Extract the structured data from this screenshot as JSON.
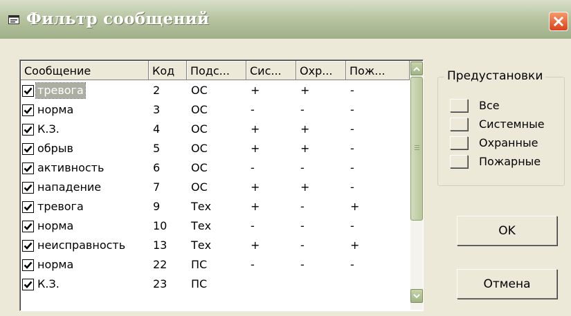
{
  "window": {
    "title": "Фильтр сообщений",
    "icon": "window-icon",
    "close_icon": "close-icon",
    "accent_color": "#d9431a"
  },
  "list": {
    "columns": [
      "Сообщение",
      "Код",
      "Подс...",
      "Сис...",
      "Охр...",
      "Пож..."
    ],
    "rows": [
      {
        "checked": true,
        "message": "тревога",
        "code": "2",
        "subsystem": "ОС",
        "system": "+",
        "security": "+",
        "fire": "-",
        "selected": true
      },
      {
        "checked": true,
        "message": "норма",
        "code": "3",
        "subsystem": "ОС",
        "system": "-",
        "security": "-",
        "fire": "-"
      },
      {
        "checked": true,
        "message": "К.З.",
        "code": "4",
        "subsystem": "ОС",
        "system": "+",
        "security": "+",
        "fire": "-"
      },
      {
        "checked": true,
        "message": "обрыв",
        "code": "5",
        "subsystem": "ОС",
        "system": "+",
        "security": "+",
        "fire": "-"
      },
      {
        "checked": true,
        "message": "активность",
        "code": "6",
        "subsystem": "ОС",
        "system": "-",
        "security": "-",
        "fire": "-"
      },
      {
        "checked": true,
        "message": "нападение",
        "code": "7",
        "subsystem": "ОС",
        "system": "+",
        "security": "+",
        "fire": "-"
      },
      {
        "checked": true,
        "message": "тревога",
        "code": "9",
        "subsystem": "Тех",
        "system": "+",
        "security": "-",
        "fire": "+"
      },
      {
        "checked": true,
        "message": "норма",
        "code": "10",
        "subsystem": "Тех",
        "system": "-",
        "security": "-",
        "fire": "-"
      },
      {
        "checked": true,
        "message": "неисправность",
        "code": "13",
        "subsystem": "Тех",
        "system": "+",
        "security": "-",
        "fire": "+"
      },
      {
        "checked": true,
        "message": "норма",
        "code": "22",
        "subsystem": "ПС",
        "system": "-",
        "security": "-",
        "fire": "-"
      },
      {
        "checked": true,
        "message": "К.З.",
        "code": "23",
        "subsystem": "ПС",
        "system": "",
        "security": "",
        "fire": ""
      }
    ]
  },
  "presets": {
    "title": "Предустановки",
    "items": [
      "Все",
      "Системные",
      "Охранные",
      "Пожарные"
    ]
  },
  "buttons": {
    "ok": "OK",
    "cancel": "Отмена"
  }
}
